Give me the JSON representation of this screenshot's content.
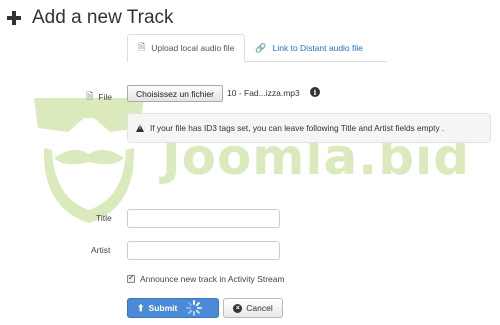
{
  "header": {
    "title": "Add a new Track"
  },
  "tabs": [
    {
      "label": "Upload local audio file",
      "icon": "file-icon",
      "active": true
    },
    {
      "label": "Link to Distant audio file",
      "icon": "link-icon",
      "active": false
    }
  ],
  "form": {
    "file_label": "File",
    "file_button": "Choisissez un fichier",
    "file_name": "10 - Fad...izza.mp3",
    "alert_text": "If your file has ID3 tags set, you can leave following Title and Artist fields empty .",
    "title_label": "Title",
    "title_value": "",
    "artist_label": "Artist",
    "artist_value": "",
    "announce_label": "Announce new track in Activity Stream",
    "announce_checked": true
  },
  "actions": {
    "submit_label": "Submit",
    "cancel_label": "Cancel"
  },
  "watermark": {
    "text": "Joomla.bid"
  },
  "colors": {
    "accent": "#4a8ad6",
    "link": "#2a6fc4",
    "watermark": "#cfe4a8"
  }
}
